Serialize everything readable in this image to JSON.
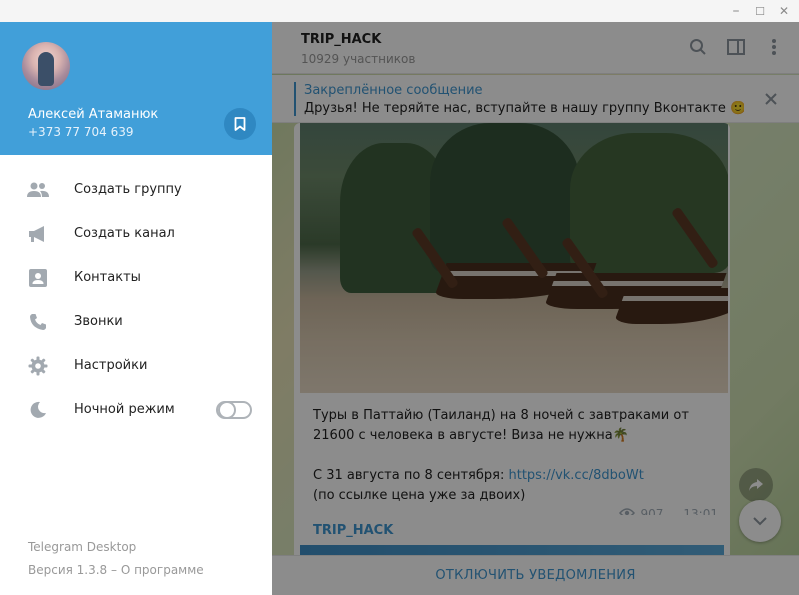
{
  "window": {
    "controls": {
      "minimize": "–",
      "maximize": "☐",
      "close": "✕"
    }
  },
  "chat": {
    "title": "TRIP_HACK",
    "subtitle": "10929 участников",
    "icons": [
      "search-icon",
      "sidebar-toggle-icon",
      "more-icon"
    ],
    "pinned": {
      "title": "Закреплённое сообщение",
      "text": "Друзья!  Не теряйте нас, вступайте в нашу группу Вконтакте 🙂 htt..."
    },
    "message": {
      "text_line1": "Туры в Паттайю (Таиланд) на 8 ночей с завтраками от 21600 с человека в августе! Виза не нужна🌴",
      "text_line2_prefix": "С 31 августа по 8 сентября: ",
      "link": "https://vk.cc/8dboWt",
      "text_line3": "(по ссылке цена уже за двоих)",
      "views": "907",
      "time": "13:01"
    },
    "next_message": {
      "title": "TRIP_HACK"
    },
    "footer_action": "ОТКЛЮЧИТЬ УВЕДОМЛЕНИЯ"
  },
  "menu": {
    "user": {
      "name": "Алексей Атаманюк",
      "phone": "+373 77 704 639"
    },
    "items": [
      {
        "label": "Создать группу",
        "icon": "group-icon"
      },
      {
        "label": "Создать канал",
        "icon": "channel-icon"
      },
      {
        "label": "Контакты",
        "icon": "contacts-icon"
      },
      {
        "label": "Звонки",
        "icon": "phone-icon"
      },
      {
        "label": "Настройки",
        "icon": "gear-icon"
      },
      {
        "label": "Ночной режим",
        "icon": "moon-icon"
      }
    ],
    "night_mode_on": false,
    "app_name": "Telegram Desktop",
    "version": "Версия 1.3.8 – ",
    "about": "О программе"
  },
  "colors": {
    "accent": "#419fd9",
    "link": "#3f96d0",
    "icon_gray": "#a2a9b0"
  }
}
